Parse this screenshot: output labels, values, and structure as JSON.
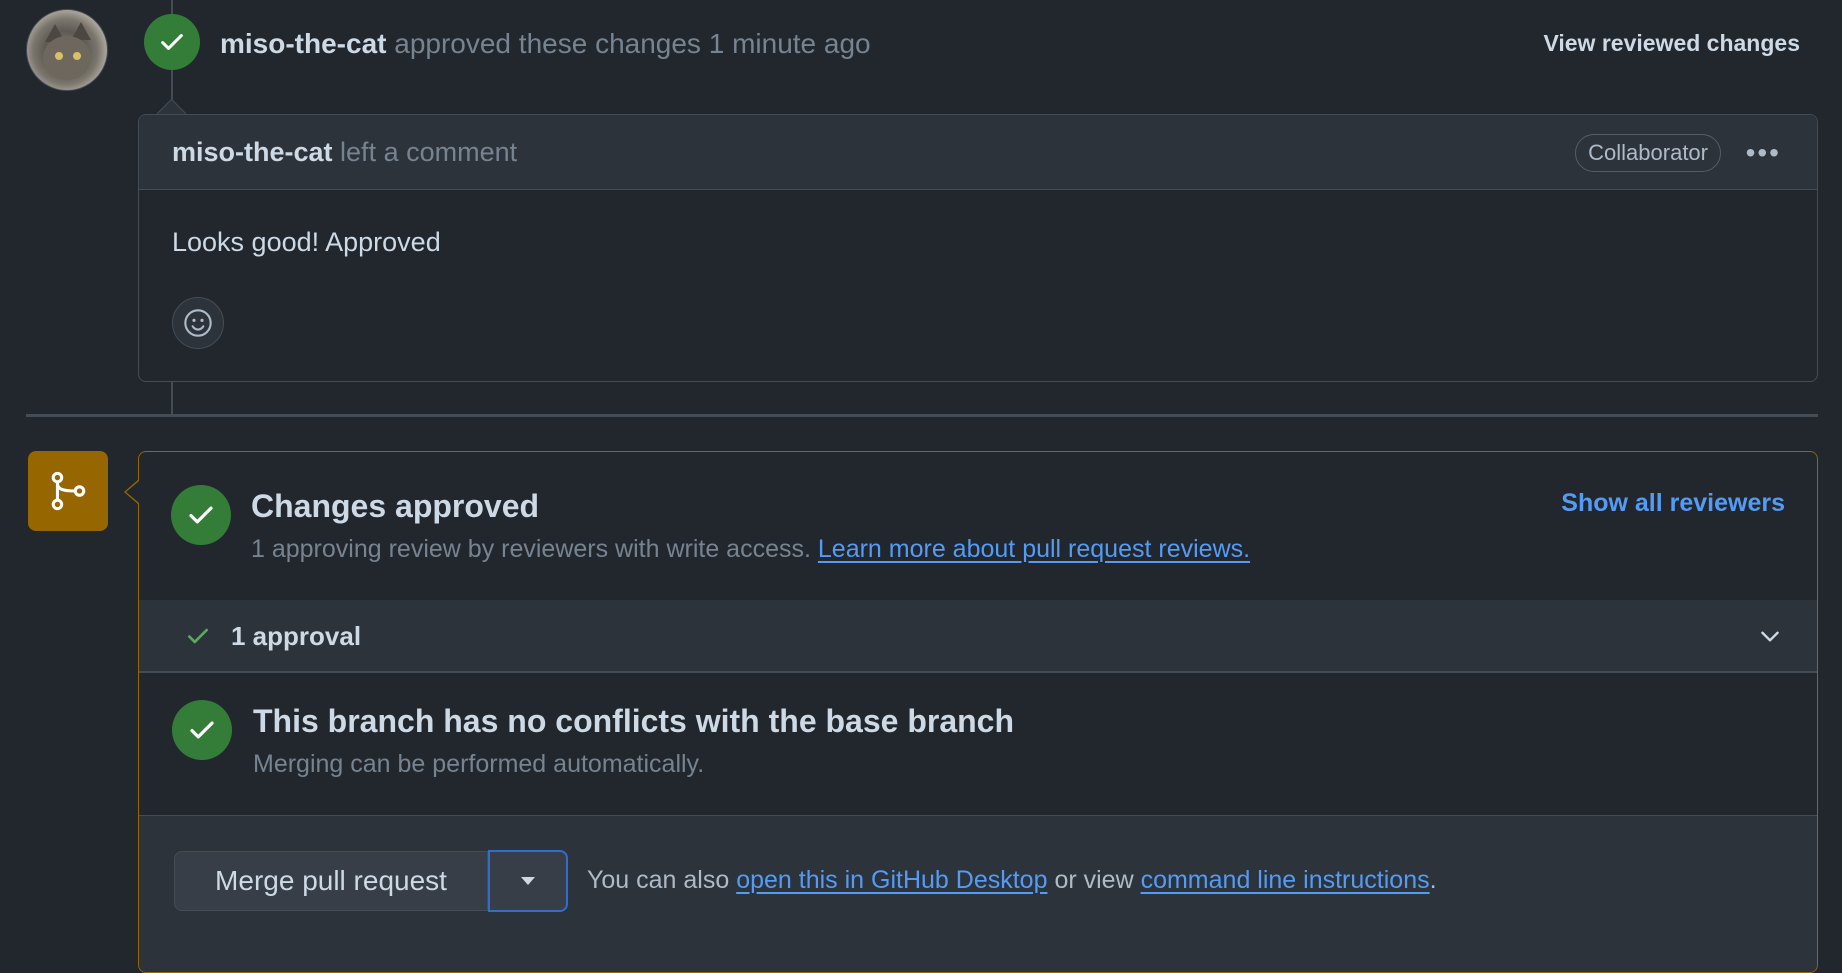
{
  "review": {
    "author": "miso-the-cat",
    "action_text": "approved these changes",
    "time": "1 minute ago",
    "view_reviewed_label": "View reviewed changes"
  },
  "comment": {
    "author": "miso-the-cat",
    "action_text": "left a comment",
    "role_badge": "Collaborator",
    "more_label": "•••",
    "body": "Looks good! Approved"
  },
  "merge_box": {
    "approved_title": "Changes approved",
    "approved_desc": "1 approving review by reviewers with write access.",
    "learn_more_link": "Learn more about pull request reviews.",
    "show_reviewers_label": "Show all reviewers",
    "approval_count_label": "1 approval",
    "conflicts_title": "This branch has no conflicts with the base branch",
    "conflicts_desc": "Merging can be performed automatically.",
    "merge_button_label": "Merge pull request",
    "also_prefix": "You can also",
    "desktop_link": "open this in GitHub Desktop",
    "or_view": "or view",
    "cli_link": "command line instructions",
    "period": "."
  },
  "colors": {
    "background": "#22272e",
    "success": "#347d39",
    "attention": "#966600",
    "link": "#539bf5"
  }
}
